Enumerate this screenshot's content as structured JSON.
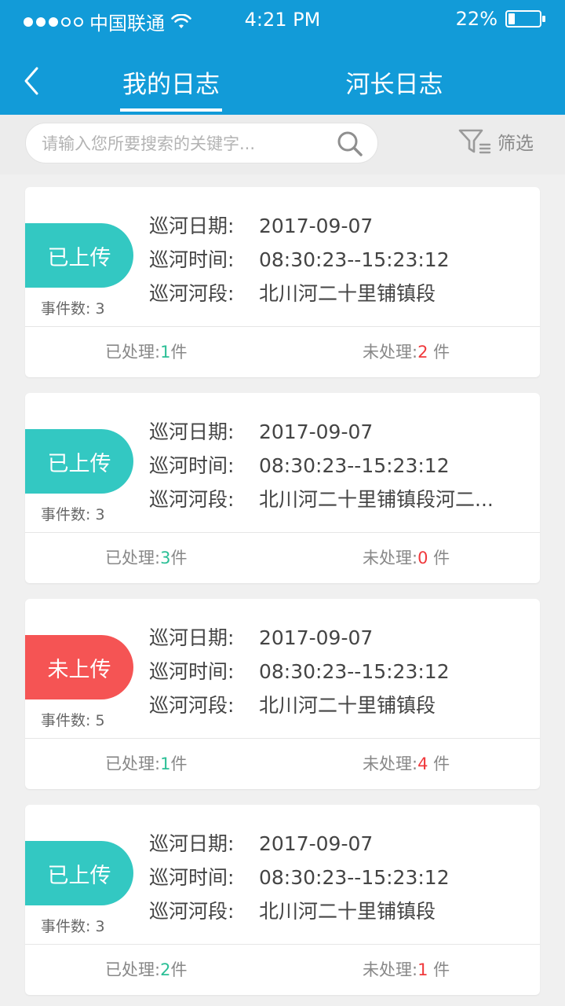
{
  "status_bar": {
    "carrier": "中国联通",
    "time": "4:21 PM",
    "battery": "22%",
    "battery_level": 0.22,
    "signal_dots_filled": 3,
    "signal_dots_total": 5,
    "icons": [
      "signal-icon",
      "wifi-icon",
      "battery-icon"
    ]
  },
  "nav": {
    "back_icon": "chevron-left-icon",
    "tabs": [
      {
        "label": "我的日志",
        "active": true
      },
      {
        "label": "河长日志",
        "active": false
      }
    ]
  },
  "search": {
    "placeholder": "请输入您所要搜索的关键字...",
    "icon": "search-icon",
    "filter_label": "筛选",
    "filter_icon": "filter-icon"
  },
  "labels": {
    "date": "巡河日期:",
    "time": "巡河时间:",
    "section": "巡河河段:",
    "event_count": "事件数:",
    "handled": "已处理:",
    "unhandled": "未处理:",
    "unit": "件"
  },
  "colors": {
    "primary": "#129bd8",
    "uploaded": "#33c8c2",
    "not_uploaded": "#f55454",
    "handled_num": "#2bbf96",
    "unhandled_num": "#f0393c"
  },
  "logs": [
    {
      "status": "已上传",
      "uploaded": true,
      "event_count": "3",
      "date": "2017-09-07",
      "time": "08:30:23--15:23:12",
      "section": "北川河二十里铺镇段",
      "handled": "1",
      "unhandled": "2"
    },
    {
      "status": "已上传",
      "uploaded": true,
      "event_count": "3",
      "date": "2017-09-07",
      "time": "08:30:23--15:23:12",
      "section": "北川河二十里铺镇段河二...",
      "handled": "3",
      "unhandled": "0"
    },
    {
      "status": "未上传",
      "uploaded": false,
      "event_count": "5",
      "date": "2017-09-07",
      "time": "08:30:23--15:23:12",
      "section": "北川河二十里铺镇段",
      "handled": "1",
      "unhandled": "4"
    },
    {
      "status": "已上传",
      "uploaded": true,
      "event_count": "3",
      "date": "2017-09-07",
      "time": "08:30:23--15:23:12",
      "section": "北川河二十里铺镇段",
      "handled": "2",
      "unhandled": "1"
    }
  ]
}
